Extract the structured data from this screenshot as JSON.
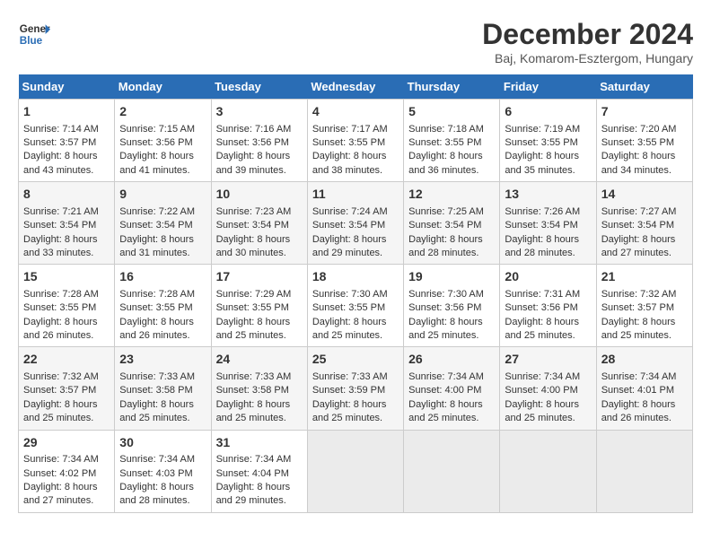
{
  "logo": {
    "line1": "General",
    "line2": "Blue"
  },
  "title": "December 2024",
  "subtitle": "Baj, Komarom-Esztergom, Hungary",
  "days_of_week": [
    "Sunday",
    "Monday",
    "Tuesday",
    "Wednesday",
    "Thursday",
    "Friday",
    "Saturday"
  ],
  "weeks": [
    [
      {
        "day": "1",
        "sunrise": "7:14 AM",
        "sunset": "3:57 PM",
        "daylight": "8 hours and 43 minutes."
      },
      {
        "day": "2",
        "sunrise": "7:15 AM",
        "sunset": "3:56 PM",
        "daylight": "8 hours and 41 minutes."
      },
      {
        "day": "3",
        "sunrise": "7:16 AM",
        "sunset": "3:56 PM",
        "daylight": "8 hours and 39 minutes."
      },
      {
        "day": "4",
        "sunrise": "7:17 AM",
        "sunset": "3:55 PM",
        "daylight": "8 hours and 38 minutes."
      },
      {
        "day": "5",
        "sunrise": "7:18 AM",
        "sunset": "3:55 PM",
        "daylight": "8 hours and 36 minutes."
      },
      {
        "day": "6",
        "sunrise": "7:19 AM",
        "sunset": "3:55 PM",
        "daylight": "8 hours and 35 minutes."
      },
      {
        "day": "7",
        "sunrise": "7:20 AM",
        "sunset": "3:55 PM",
        "daylight": "8 hours and 34 minutes."
      }
    ],
    [
      {
        "day": "8",
        "sunrise": "7:21 AM",
        "sunset": "3:54 PM",
        "daylight": "8 hours and 33 minutes."
      },
      {
        "day": "9",
        "sunrise": "7:22 AM",
        "sunset": "3:54 PM",
        "daylight": "8 hours and 31 minutes."
      },
      {
        "day": "10",
        "sunrise": "7:23 AM",
        "sunset": "3:54 PM",
        "daylight": "8 hours and 30 minutes."
      },
      {
        "day": "11",
        "sunrise": "7:24 AM",
        "sunset": "3:54 PM",
        "daylight": "8 hours and 29 minutes."
      },
      {
        "day": "12",
        "sunrise": "7:25 AM",
        "sunset": "3:54 PM",
        "daylight": "8 hours and 28 minutes."
      },
      {
        "day": "13",
        "sunrise": "7:26 AM",
        "sunset": "3:54 PM",
        "daylight": "8 hours and 28 minutes."
      },
      {
        "day": "14",
        "sunrise": "7:27 AM",
        "sunset": "3:54 PM",
        "daylight": "8 hours and 27 minutes."
      }
    ],
    [
      {
        "day": "15",
        "sunrise": "7:28 AM",
        "sunset": "3:55 PM",
        "daylight": "8 hours and 26 minutes."
      },
      {
        "day": "16",
        "sunrise": "7:28 AM",
        "sunset": "3:55 PM",
        "daylight": "8 hours and 26 minutes."
      },
      {
        "day": "17",
        "sunrise": "7:29 AM",
        "sunset": "3:55 PM",
        "daylight": "8 hours and 25 minutes."
      },
      {
        "day": "18",
        "sunrise": "7:30 AM",
        "sunset": "3:55 PM",
        "daylight": "8 hours and 25 minutes."
      },
      {
        "day": "19",
        "sunrise": "7:30 AM",
        "sunset": "3:56 PM",
        "daylight": "8 hours and 25 minutes."
      },
      {
        "day": "20",
        "sunrise": "7:31 AM",
        "sunset": "3:56 PM",
        "daylight": "8 hours and 25 minutes."
      },
      {
        "day": "21",
        "sunrise": "7:32 AM",
        "sunset": "3:57 PM",
        "daylight": "8 hours and 25 minutes."
      }
    ],
    [
      {
        "day": "22",
        "sunrise": "7:32 AM",
        "sunset": "3:57 PM",
        "daylight": "8 hours and 25 minutes."
      },
      {
        "day": "23",
        "sunrise": "7:33 AM",
        "sunset": "3:58 PM",
        "daylight": "8 hours and 25 minutes."
      },
      {
        "day": "24",
        "sunrise": "7:33 AM",
        "sunset": "3:58 PM",
        "daylight": "8 hours and 25 minutes."
      },
      {
        "day": "25",
        "sunrise": "7:33 AM",
        "sunset": "3:59 PM",
        "daylight": "8 hours and 25 minutes."
      },
      {
        "day": "26",
        "sunrise": "7:34 AM",
        "sunset": "4:00 PM",
        "daylight": "8 hours and 25 minutes."
      },
      {
        "day": "27",
        "sunrise": "7:34 AM",
        "sunset": "4:00 PM",
        "daylight": "8 hours and 25 minutes."
      },
      {
        "day": "28",
        "sunrise": "7:34 AM",
        "sunset": "4:01 PM",
        "daylight": "8 hours and 26 minutes."
      }
    ],
    [
      {
        "day": "29",
        "sunrise": "7:34 AM",
        "sunset": "4:02 PM",
        "daylight": "8 hours and 27 minutes."
      },
      {
        "day": "30",
        "sunrise": "7:34 AM",
        "sunset": "4:03 PM",
        "daylight": "8 hours and 28 minutes."
      },
      {
        "day": "31",
        "sunrise": "7:34 AM",
        "sunset": "4:04 PM",
        "daylight": "8 hours and 29 minutes."
      },
      null,
      null,
      null,
      null
    ]
  ],
  "labels": {
    "sunrise": "Sunrise:",
    "sunset": "Sunset:",
    "daylight": "Daylight hours"
  }
}
